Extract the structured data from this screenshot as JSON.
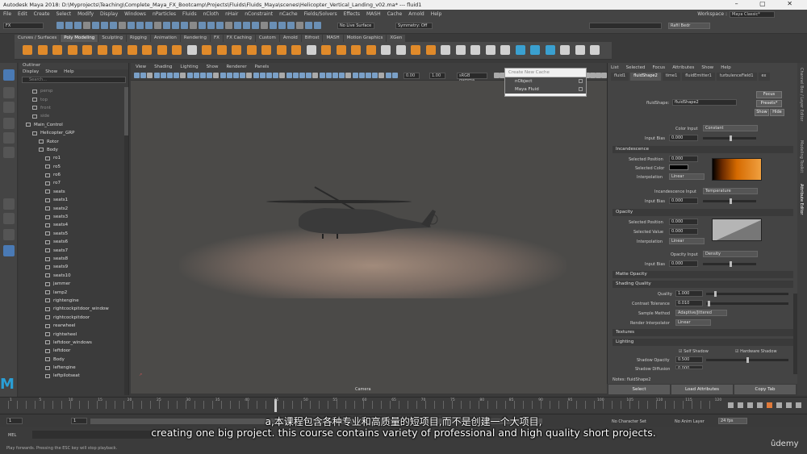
{
  "window": {
    "title": "Autodesk Maya 2018: D:\\Myprojects\\Teaching\\Complete_Maya_FX_Bootcamp\\Projects\\Fluids\\Fluids_Maya\\scenes\\Helicopter_Vertical_Landing_v02.ma*  ---  fluid1",
    "controls": "– ▢ ✕"
  },
  "menubar": [
    "File",
    "Edit",
    "Create",
    "Select",
    "Modify",
    "Display",
    "Windows",
    "nParticles",
    "Fluids",
    "nCloth",
    "nHair",
    "nConstraint",
    "nCache",
    "Fields/Solvers",
    "Effects",
    "MASH",
    "Cache",
    "Arnold",
    "Help"
  ],
  "workspace": {
    "label": "Workspace :",
    "value": "Maya Classic*"
  },
  "statusline": {
    "mode": "FX",
    "live_surface": "No Live Surface",
    "symmetry": "Symmetry: Off",
    "user": "Rafil Bedr"
  },
  "shelf_tabs": [
    "Curves / Surfaces",
    "Poly Modeling",
    "Sculpting",
    "Rigging",
    "Animation",
    "Rendering",
    "FX",
    "FX Caching",
    "Custom",
    "Arnold",
    "Bifrost",
    "MASH",
    "Motion Graphics",
    "XGen"
  ],
  "outliner": {
    "title": "Outliner",
    "menu": [
      "Display",
      "Show",
      "Help"
    ],
    "search_placeholder": "Search...",
    "items": [
      {
        "label": "persp",
        "indent": 2,
        "dim": true
      },
      {
        "label": "top",
        "indent": 2,
        "dim": true
      },
      {
        "label": "front",
        "indent": 2,
        "dim": true
      },
      {
        "label": "side",
        "indent": 2,
        "dim": true
      },
      {
        "label": "Main_Control",
        "indent": 1,
        "dim": false
      },
      {
        "label": "Helicopter_GRP",
        "indent": 2,
        "dim": false
      },
      {
        "label": "Rotor",
        "indent": 3,
        "dim": false
      },
      {
        "label": "Body",
        "indent": 3,
        "dim": false
      },
      {
        "label": "ro1",
        "indent": 4,
        "dim": false
      },
      {
        "label": "ro5",
        "indent": 4,
        "dim": false
      },
      {
        "label": "ro6",
        "indent": 4,
        "dim": false
      },
      {
        "label": "ro7",
        "indent": 4,
        "dim": false
      },
      {
        "label": "seats",
        "indent": 4,
        "dim": false
      },
      {
        "label": "seats1",
        "indent": 4,
        "dim": false
      },
      {
        "label": "seats2",
        "indent": 4,
        "dim": false
      },
      {
        "label": "seats3",
        "indent": 4,
        "dim": false
      },
      {
        "label": "seats4",
        "indent": 4,
        "dim": false
      },
      {
        "label": "seats5",
        "indent": 4,
        "dim": false
      },
      {
        "label": "seats6",
        "indent": 4,
        "dim": false
      },
      {
        "label": "seats7",
        "indent": 4,
        "dim": false
      },
      {
        "label": "seats8",
        "indent": 4,
        "dim": false
      },
      {
        "label": "seats9",
        "indent": 4,
        "dim": false
      },
      {
        "label": "seats10",
        "indent": 4,
        "dim": false
      },
      {
        "label": "jammer",
        "indent": 4,
        "dim": false
      },
      {
        "label": "lamp2",
        "indent": 4,
        "dim": false
      },
      {
        "label": "rightengine",
        "indent": 4,
        "dim": false
      },
      {
        "label": "rightcockpitdoor_window",
        "indent": 4,
        "dim": false
      },
      {
        "label": "rightcockpitdoor",
        "indent": 4,
        "dim": false
      },
      {
        "label": "rearwheel",
        "indent": 4,
        "dim": false
      },
      {
        "label": "rightwheel",
        "indent": 4,
        "dim": false
      },
      {
        "label": "leftdoor_windows",
        "indent": 4,
        "dim": false
      },
      {
        "label": "leftdoor",
        "indent": 4,
        "dim": false
      },
      {
        "label": "Body",
        "indent": 4,
        "dim": false
      },
      {
        "label": "leftengine",
        "indent": 4,
        "dim": false
      },
      {
        "label": "leftpilotseat",
        "indent": 4,
        "dim": false
      }
    ]
  },
  "viewport": {
    "menu": [
      "View",
      "Shading",
      "Lighting",
      "Show",
      "Renderer",
      "Panels"
    ],
    "field1": "0.00",
    "field2": "1.00",
    "colorspace": "sRGB gamma",
    "camera": "Camera"
  },
  "cache_menu": {
    "header": "Create New Cache",
    "items": [
      "nObject",
      "Maya Fluid"
    ]
  },
  "attr_editor": {
    "menu": [
      "List",
      "Selected",
      "Focus",
      "Attributes",
      "Show",
      "Help"
    ],
    "tabs": [
      "fluid1",
      "fluidShape2",
      "time1",
      "fluidEmitter1",
      "turbulenceField1",
      "ex"
    ],
    "shape_label": "fluidShape:",
    "shape_value": "fluidShape2",
    "focus": "Focus",
    "presets": "Presets*",
    "show": "Show",
    "hide": "Hide",
    "color_input_label": "Color Input",
    "color_input": "Constant",
    "input_bias_label": "Input Bias",
    "input_bias": "0.000",
    "incandescence": "Incandescence",
    "selected_position_label": "Selected Position",
    "inc_selected_position": "0.000",
    "selected_color_label": "Selected Color",
    "interpolation_label": "Interpolation",
    "inc_interpolation": "Linear",
    "inc_input_label": "Incandescence Input",
    "inc_input": "Temperature",
    "inc_input_bias": "0.000",
    "opacity": "Opacity",
    "op_selected_position": "0.000",
    "selected_value_label": "Selected Value",
    "op_selected_value": "0.000",
    "op_interpolation": "Linear",
    "opacity_input_label": "Opacity Input",
    "opacity_input": "Density",
    "op_input_bias": "0.000",
    "matte_opacity": "Matte Opacity",
    "shading_quality": "Shading Quality",
    "quality_label": "Quality",
    "quality": "1.000",
    "contrast_label": "Contrast Tolerance",
    "contrast": "0.010",
    "sample_method_label": "Sample Method",
    "sample_method": "Adaptive/Jittered",
    "render_interp_label": "Render Interpolator",
    "render_interp": "Linear",
    "textures": "Textures",
    "lighting": "Lighting",
    "self_shadow": "Self Shadow",
    "hardware_shadow": "Hardware Shadow",
    "shadow_opacity_label": "Shadow Opacity",
    "shadow_opacity": "0.500",
    "shadow_diffusion_label": "Shadow Diffusion",
    "shadow_diffusion": "0.000",
    "notes": "Notes: fluidShape2",
    "buttons": [
      "Select",
      "Load Attributes",
      "Copy Tab"
    ]
  },
  "right_strip": [
    "Channel Box / Layer Editor",
    "Modeling Toolkit",
    "Attribute Editor"
  ],
  "timeline": {
    "ticks": [
      "1",
      "5",
      "10",
      "15",
      "20",
      "25",
      "30",
      "35",
      "40",
      "45",
      "50",
      "55",
      "60",
      "65",
      "70",
      "75",
      "80",
      "85",
      "90",
      "95",
      "100",
      "105",
      "110",
      "115",
      "120"
    ],
    "current": "30"
  },
  "range": {
    "start": "1",
    "inner_start": "1",
    "end": "120",
    "char_set": "No Character Set",
    "anim_layer": "No Anim Layer",
    "fps": "24 fps"
  },
  "cmdline": {
    "label": "MEL"
  },
  "helpline": "Play forwards. Pressing the ESC key will stop playback.",
  "subtitles": {
    "zh": "a,本课程包含各种专业和高质量的短项目,而不是创建一个大项目,",
    "en": "creating one big project. this course contains variety of professional and high quality short projects."
  },
  "watermark": "ûdemy",
  "maya_logo": "M"
}
